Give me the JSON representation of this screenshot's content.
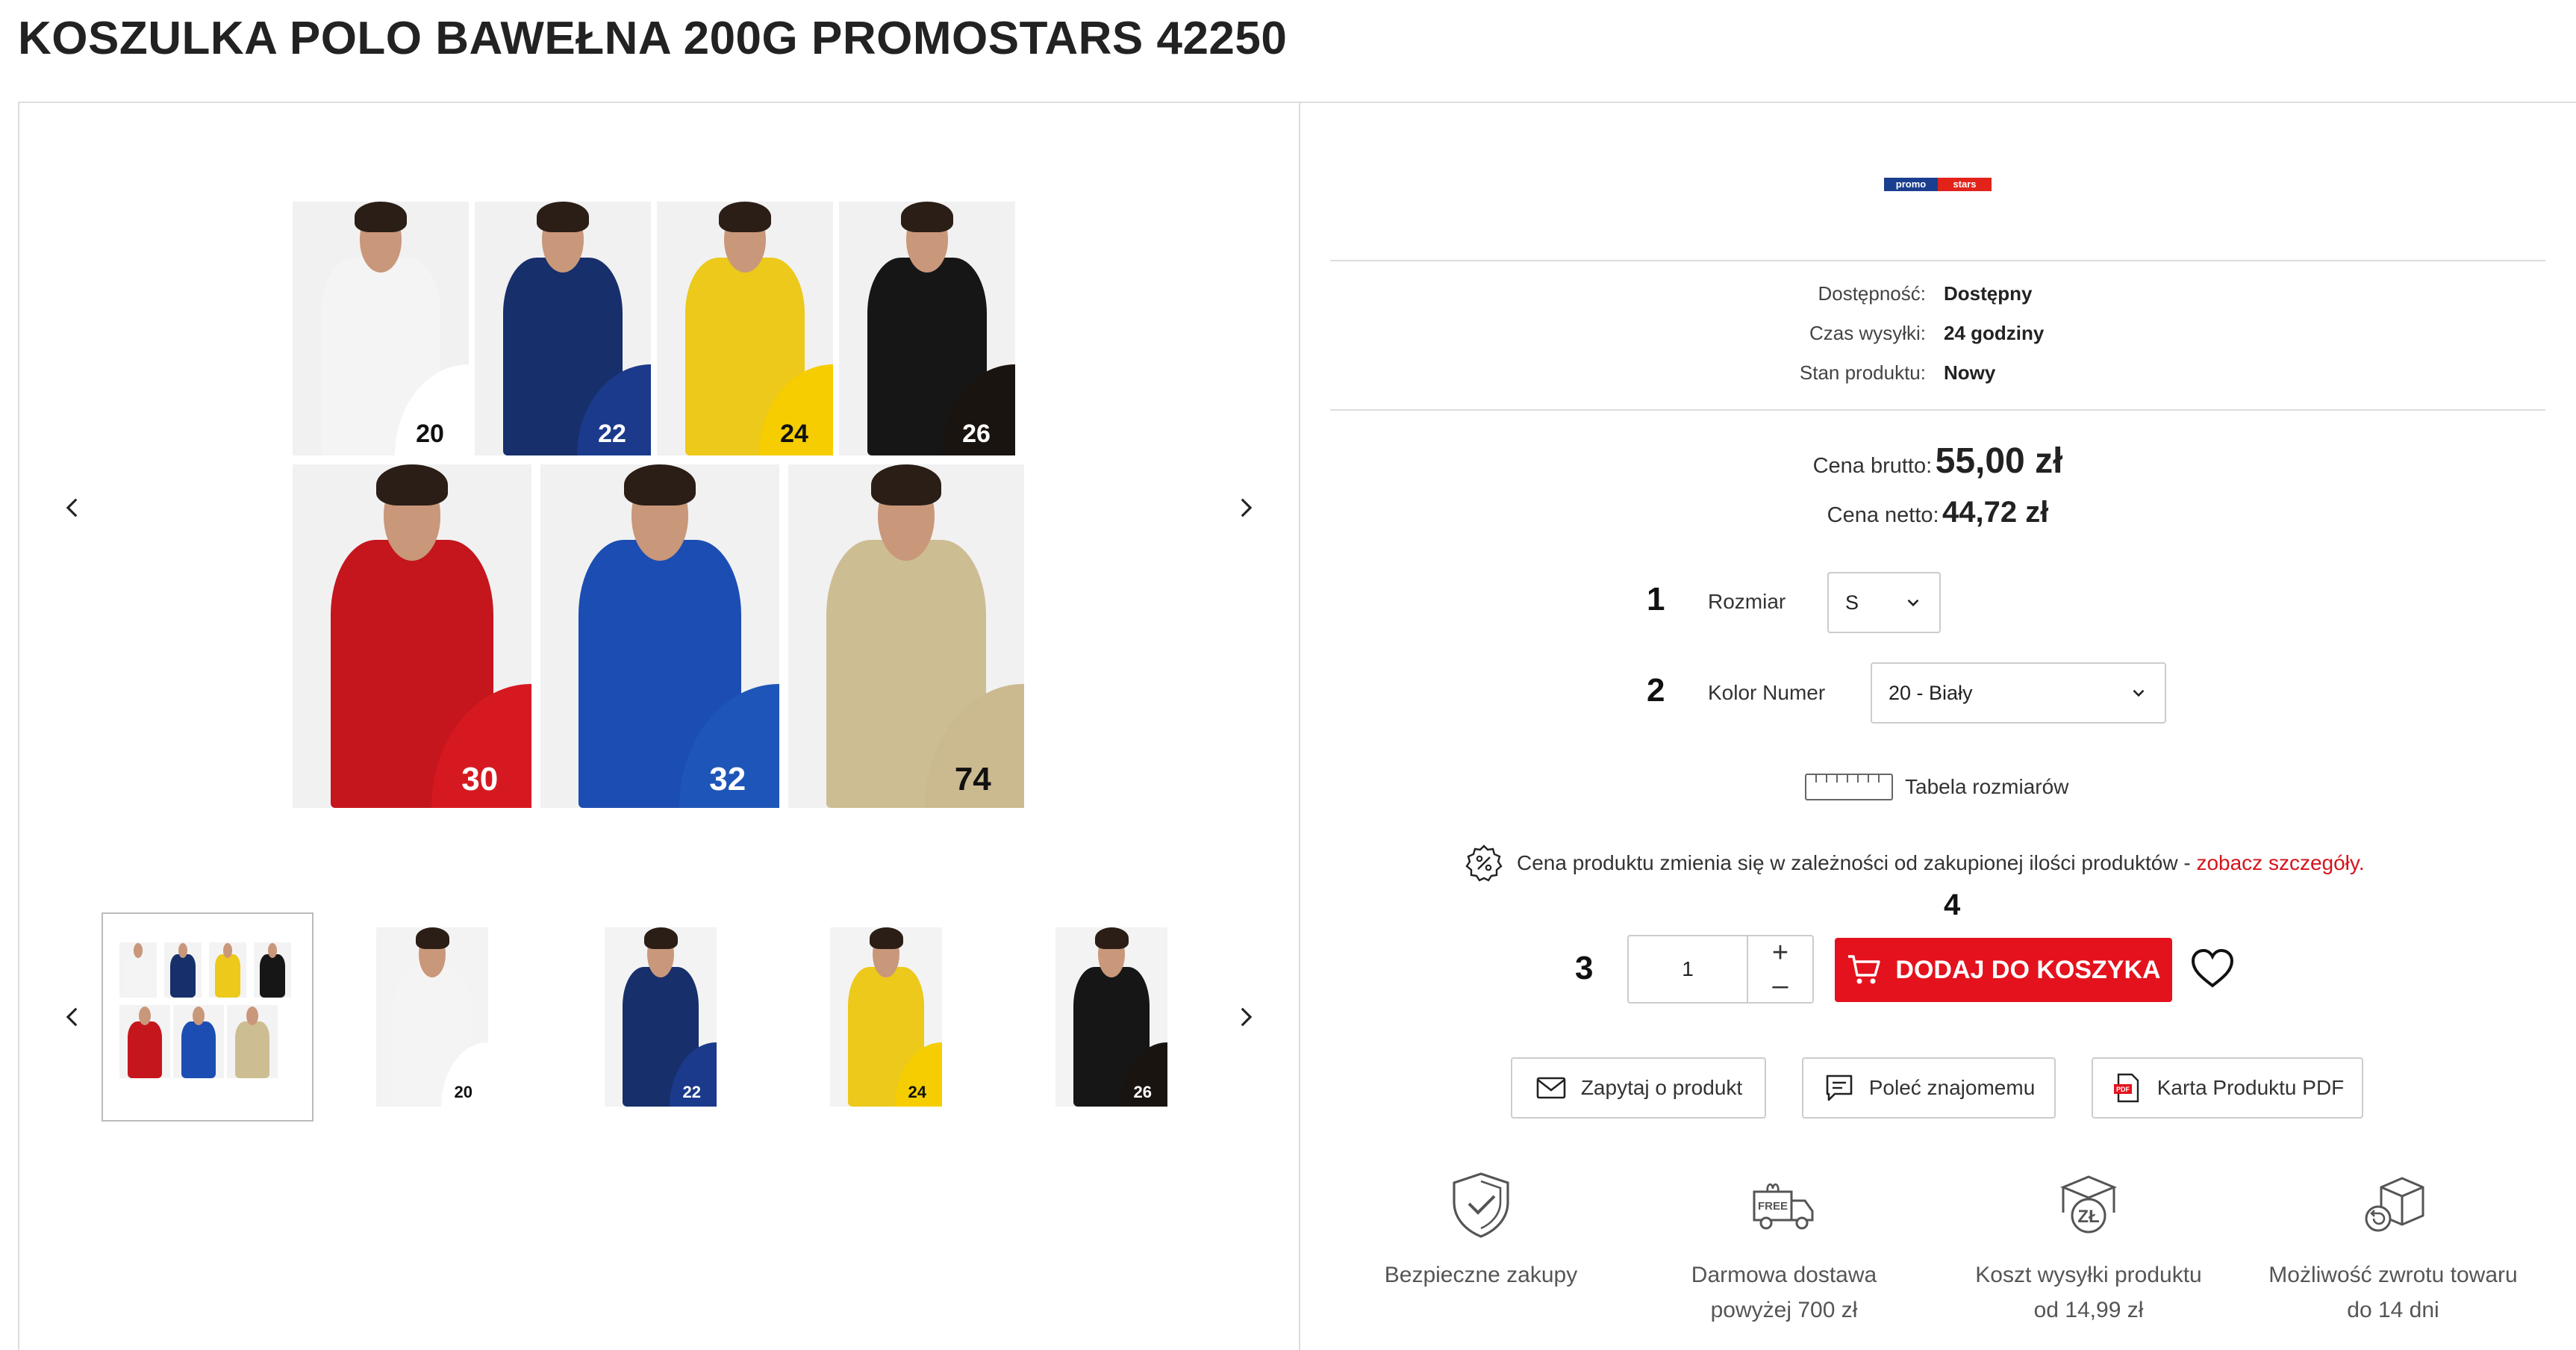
{
  "product": {
    "title": "KOSZULKA POLO BAWEŁNA 200G PROMOSTARS 42250",
    "brand_logo": [
      "promo",
      "stars"
    ]
  },
  "gallery": {
    "main_tiles": [
      {
        "badge": "20",
        "shirt_color": "#f4f4f4",
        "badge_color": "#ffffff",
        "badge_text_color": "#111111"
      },
      {
        "badge": "22",
        "shirt_color": "#172f6b",
        "badge_color": "#1b3a8c",
        "badge_text_color": "#ffffff"
      },
      {
        "badge": "24",
        "shirt_color": "#ecc91a",
        "badge_color": "#f5cd00",
        "badge_text_color": "#111111"
      },
      {
        "badge": "26",
        "shirt_color": "#161616",
        "badge_color": "#1a1410",
        "badge_text_color": "#ffffff"
      },
      {
        "badge": "30",
        "shirt_color": "#c5161d",
        "badge_color": "#d61920",
        "badge_text_color": "#ffffff"
      },
      {
        "badge": "32",
        "shirt_color": "#1c4db3",
        "badge_color": "#1e55b8",
        "badge_text_color": "#ffffff"
      },
      {
        "badge": "74",
        "shirt_color": "#cdbd92",
        "badge_color": "#cbb990",
        "badge_text_color": "#111111"
      }
    ],
    "thumbnails": [
      {
        "badge": ""
      },
      {
        "badge": "20"
      },
      {
        "badge": "22"
      },
      {
        "badge": "24"
      },
      {
        "badge": "26"
      }
    ]
  },
  "info": {
    "availability_label": "Dostępność:",
    "availability_value": "Dostępny",
    "shipping_label": "Czas wysyłki:",
    "shipping_value": "24 godziny",
    "condition_label": "Stan produktu:",
    "condition_value": "Nowy"
  },
  "price": {
    "gross_label": "Cena brutto:",
    "gross_value": "55,00 zł",
    "net_label": "Cena netto:",
    "net_value": "44,72 zł"
  },
  "options": {
    "size_num": "1",
    "size_label": "Rozmiar",
    "size_value": "S",
    "color_num": "2",
    "color_label": "Kolor Numer",
    "color_value": "20 - Biały",
    "size_table": "Tabela rozmiarów"
  },
  "promo": {
    "text": "Cena produktu zmienia się w zależności od zakupionej ilości produktów - ",
    "link": "zobacz szczegóły."
  },
  "cart": {
    "qty_num": "3",
    "qty_value": "1",
    "plus": "+",
    "minus": "–",
    "btn_num": "4",
    "add_label": "DODAJ DO KOSZYKA"
  },
  "actions": {
    "ask": "Zapytaj o produkt",
    "recommend": "Poleć znajomemu",
    "pdf": "Karta Produktu PDF"
  },
  "features": [
    {
      "line1": "Bezpieczne zakupy",
      "line2": ""
    },
    {
      "line1": "Darmowa dostawa",
      "line2": "powyżej 700 zł"
    },
    {
      "line1": "Koszt wysyłki produktu",
      "line2": "od 14,99 zł"
    },
    {
      "line1": "Możliwość zwrotu towaru",
      "line2": "do 14 dni"
    }
  ],
  "colors": {
    "accent": "#e4121d",
    "link": "#d4141c"
  }
}
